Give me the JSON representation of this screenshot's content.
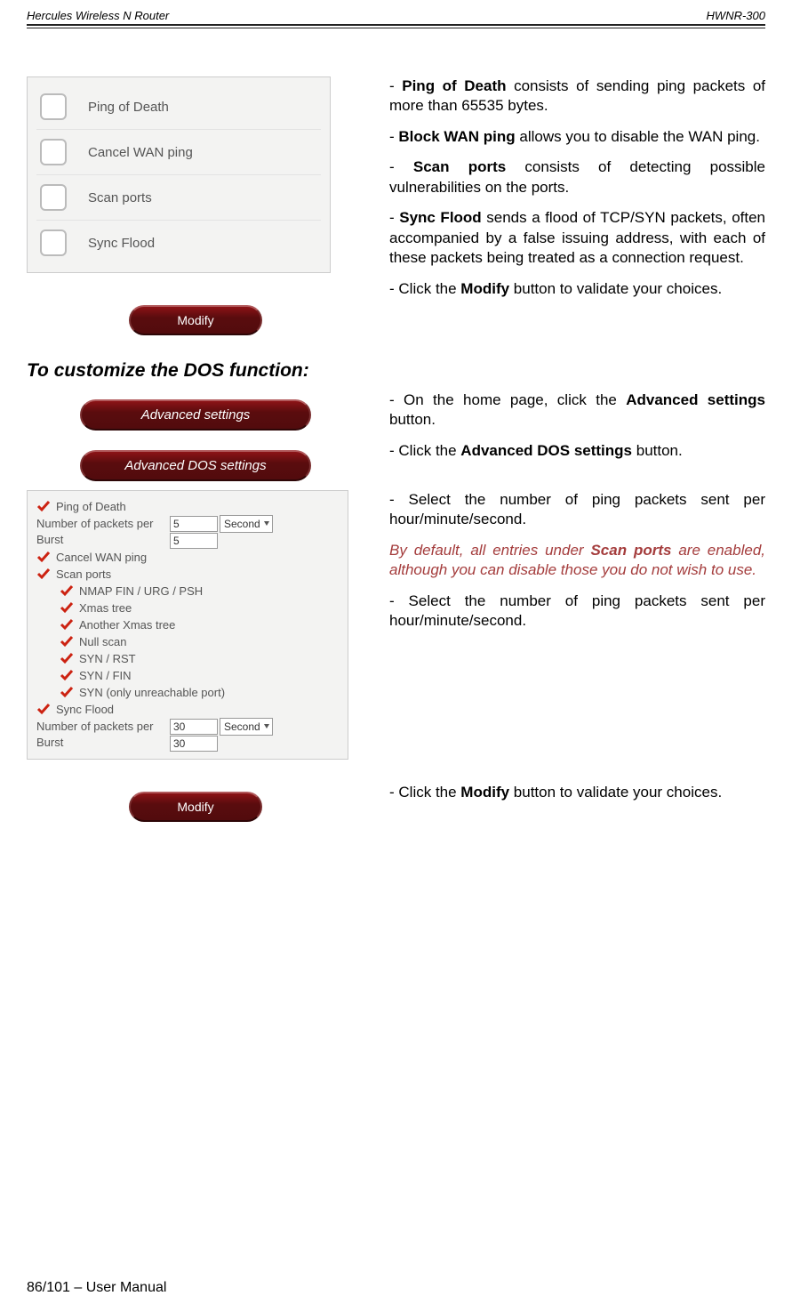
{
  "header": {
    "left": "Hercules Wireless N Router",
    "right": "HWNR-300"
  },
  "footer": "86/101 – User Manual",
  "panel1": {
    "rows": [
      {
        "label": "Ping of Death"
      },
      {
        "label": "Cancel WAN ping"
      },
      {
        "label": "Scan ports"
      },
      {
        "label": "Sync Flood"
      }
    ]
  },
  "buttons": {
    "modify": "Modify",
    "advanced_settings": "Advanced settings",
    "advanced_dos": "Advanced DOS settings"
  },
  "heading": "To customize the DOS function:",
  "dos_panel": {
    "ping_of_death": "Ping of Death",
    "num_label": "Number of packets per",
    "burst_label": "Burst",
    "top_num": "5",
    "top_sel": "Second",
    "top_burst": "5",
    "cancel_wan": "Cancel WAN ping",
    "scan_ports": "Scan ports",
    "sub": [
      "NMAP FIN / URG / PSH",
      "Xmas tree",
      "Another Xmas tree",
      "Null scan",
      "SYN / RST",
      "SYN / FIN",
      "SYN (only unreachable port)"
    ],
    "sync_flood": "Sync Flood",
    "bot_num": "30",
    "bot_sel": "Second",
    "bot_burst": "30"
  },
  "text": {
    "p1a": "- ",
    "p1b": "Ping of Death",
    "p1c": " consists of sending ping packets of more than 65535 bytes.",
    "p2a": "- ",
    "p2b": "Block WAN ping",
    "p2c": " allows you to disable the WAN ping.",
    "p3a": "- ",
    "p3b": "Scan ports",
    "p3c": " consists of detecting possible vulnerabilities on the ports.",
    "p4a": "- ",
    "p4b": "Sync Flood",
    "p4c": " sends a flood of TCP/SYN packets, often accompanied by a false issuing address, with each of these packets being treated as a connection request.",
    "p5a": "- Click the ",
    "p5b": "Modify",
    "p5c": " button to validate your choices.",
    "p6a": "- On the home page, click the ",
    "p6b": "Advanced settings",
    "p6c": " button.",
    "p7a": "- Click the ",
    "p7b": "Advanced DOS settings",
    "p7c": " button.",
    "p8": "- Select the number of ping packets sent per hour/minute/second.",
    "p9a": "By default, all entries under ",
    "p9b": "Scan ports",
    "p9c": " are enabled, although you can disable those you do not wish to use.",
    "p10": "- Select the number of ping packets sent per hour/minute/second.",
    "p11a": "- Click the ",
    "p11b": "Modify",
    "p11c": " button to validate your choices."
  }
}
